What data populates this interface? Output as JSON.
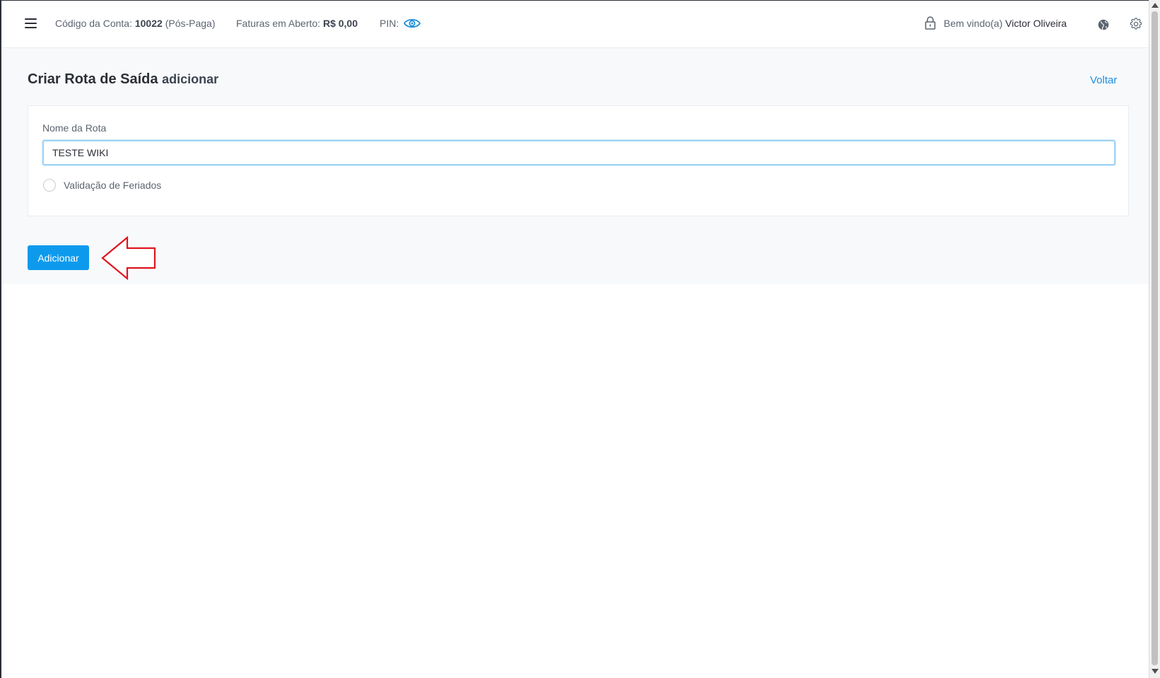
{
  "header": {
    "account_code_label": "Código da Conta:",
    "account_code_value": "10022",
    "account_type": "(Pós-Paga)",
    "open_invoices_label": "Faturas em Aberto:",
    "open_invoices_value": "R$ 0,00",
    "pin_label": "PIN:",
    "welcome_label": "Bem vindo(a)",
    "user_name": "Victor Oliveira",
    "icons": {
      "menu": "hamburger-menu-icon",
      "pin": "eye-icon",
      "lock": "lock-icon",
      "globe": "globe-icon",
      "settings": "gear-icon"
    }
  },
  "page": {
    "title": "Criar Rota de Saída",
    "subtitle": "adicionar",
    "back_label": "Voltar"
  },
  "form": {
    "route_name_label": "Nome da Rota",
    "route_name_value": "TESTE WIKI",
    "holiday_validation_label": "Validação de Feriados",
    "holiday_validation_checked": false,
    "submit_label": "Adicionar"
  },
  "colors": {
    "accent": "#0d9aed",
    "link": "#1e8fe0",
    "annotation_arrow": "#e0141e"
  }
}
